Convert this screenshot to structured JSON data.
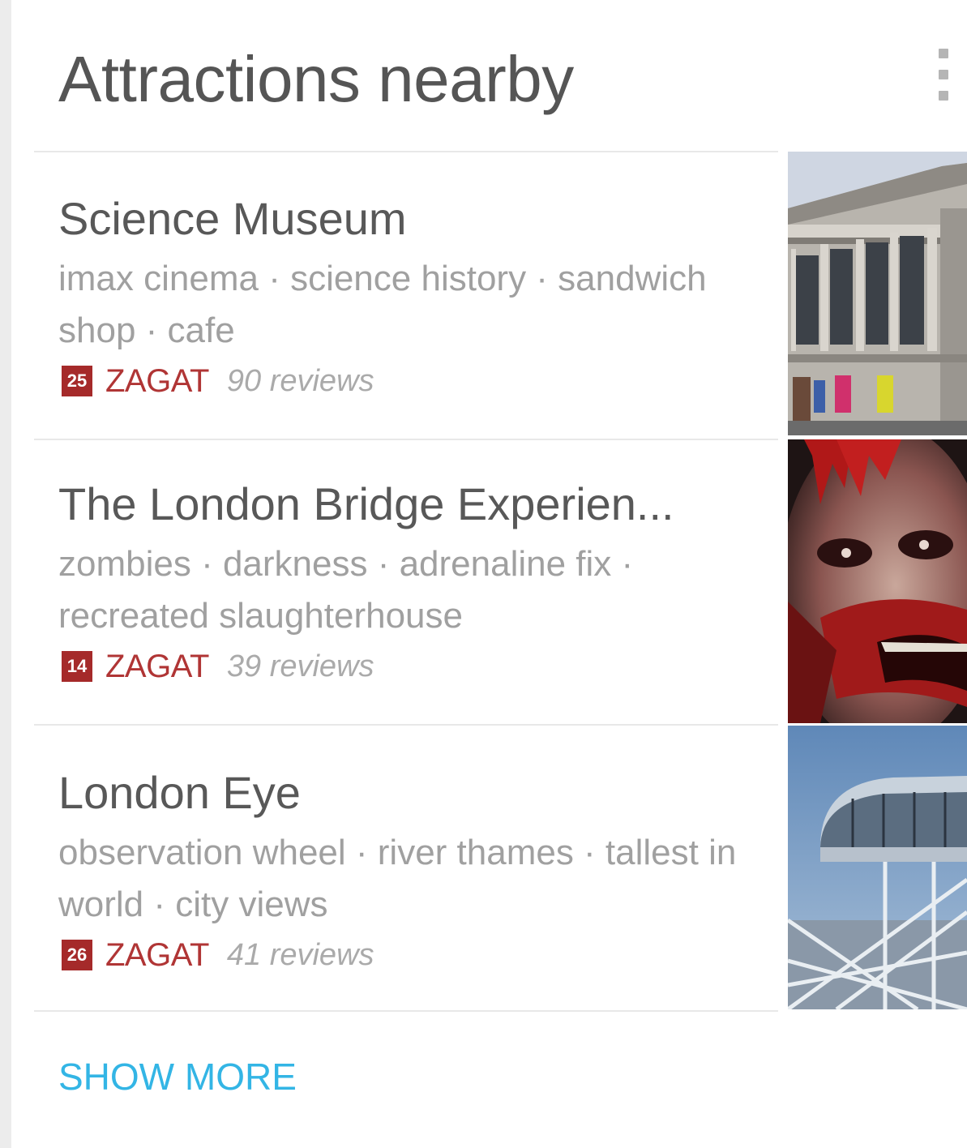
{
  "card": {
    "title": "Attractions nearby",
    "menu_icon": "overflow-menu-icon",
    "show_more_label": "SHOW MORE"
  },
  "items": [
    {
      "name": "Science Museum",
      "tags": "imax cinema · science history · sandwich shop · cafe",
      "score": "25",
      "source": "ZAGAT",
      "reviews": "90 reviews",
      "image": "museum-building-photo"
    },
    {
      "name": "The London Bridge Experien...",
      "tags": "zombies · darkness · adrenaline fix · recreated slaughterhouse",
      "score": "14",
      "source": "ZAGAT",
      "reviews": "39 reviews",
      "image": "zombie-face-photo"
    },
    {
      "name": "London Eye",
      "tags": "observation wheel · river thames · tallest in world · city views",
      "score": "26",
      "source": "ZAGAT",
      "reviews": "41 reviews",
      "image": "london-eye-capsule-photo"
    }
  ],
  "colors": {
    "accent_blue": "#33b5e5",
    "zagat_red": "#a52a2a",
    "title_gray": "#555555",
    "tag_gray": "#a0a0a0"
  }
}
